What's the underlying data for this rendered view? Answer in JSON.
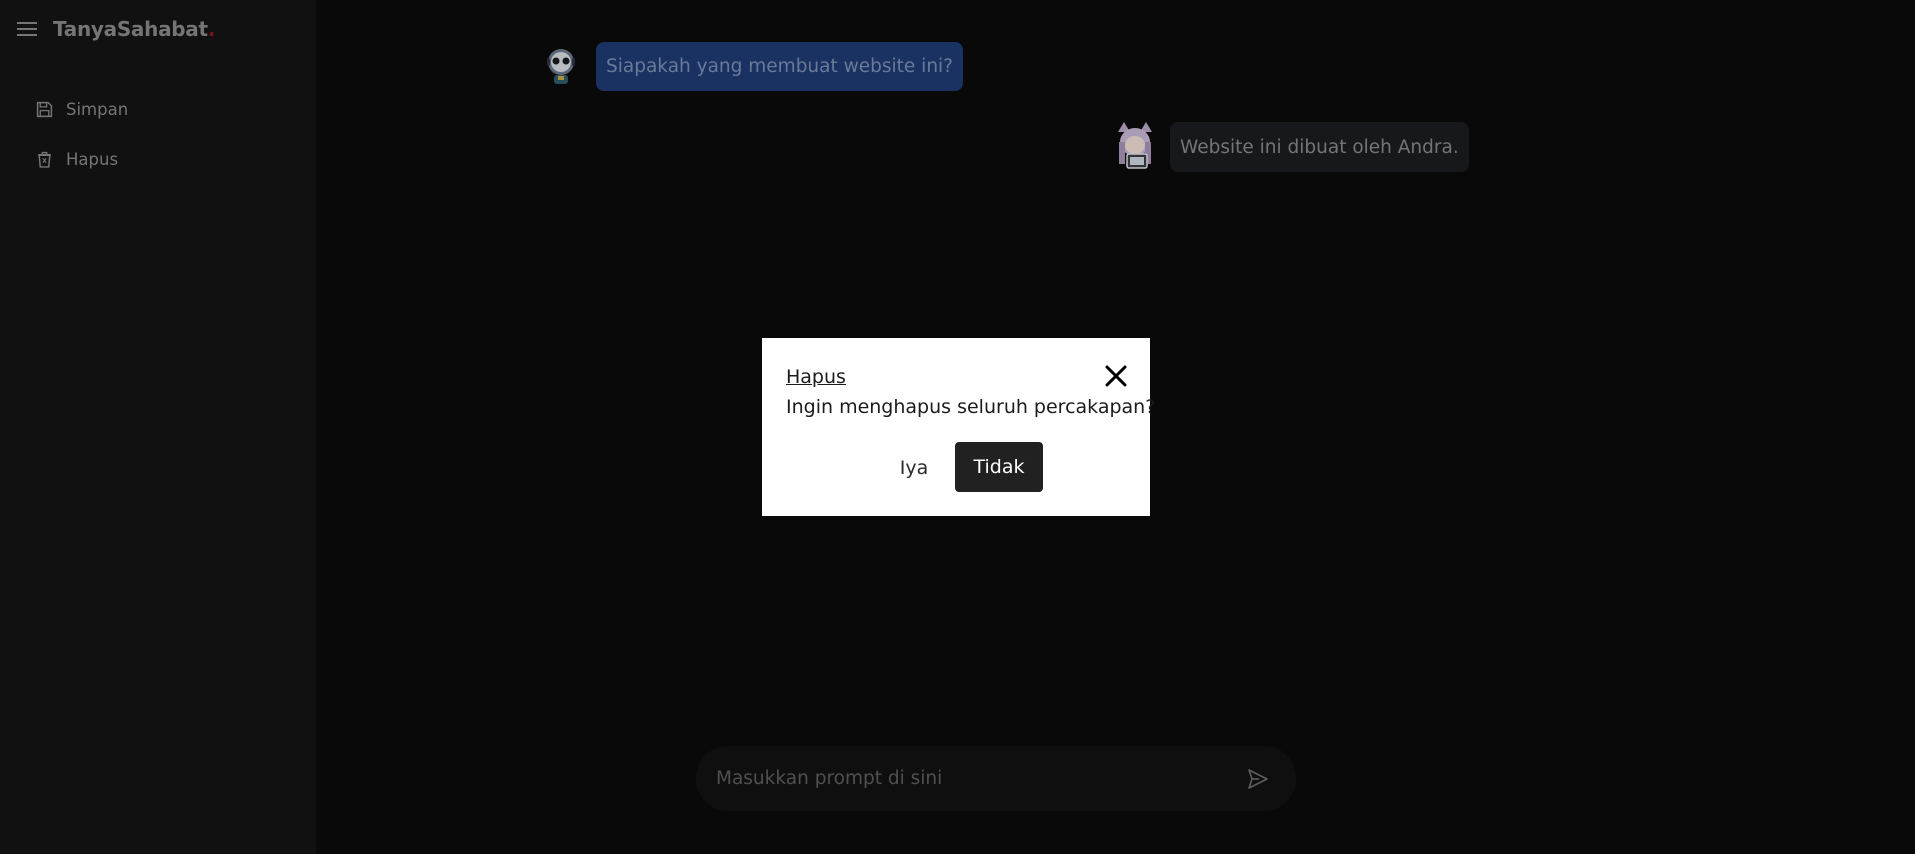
{
  "sidebar": {
    "menu_icon": "hamburger-menu-icon",
    "brand_name": "TanyaSahabat",
    "brand_dot": ".",
    "brand_dot_color": "#8b1a1a",
    "items": [
      {
        "label": "Simpan",
        "icon": "floppy-disk-icon"
      },
      {
        "label": "Hapus",
        "icon": "trash-icon"
      }
    ]
  },
  "chat": {
    "messages": [
      {
        "role": "user",
        "text": "Siapakah yang membuat website ini?",
        "avatar": "robot-avatar",
        "bubble_color": "#1e3b73"
      },
      {
        "role": "assistant",
        "text": "Website ini dibuat oleh Andra.",
        "avatar": "anime-girl-avatar",
        "bubble_color": "#1b1d22"
      }
    ]
  },
  "prompt": {
    "placeholder": "Masukkan prompt di sini",
    "value": "",
    "send_icon": "send-icon"
  },
  "modal": {
    "title": "Hapus",
    "message": "Ingin menghapus seluruh percakapan?",
    "confirm_label": "Iya",
    "cancel_label": "Tidak",
    "close_icon": "close-icon"
  }
}
